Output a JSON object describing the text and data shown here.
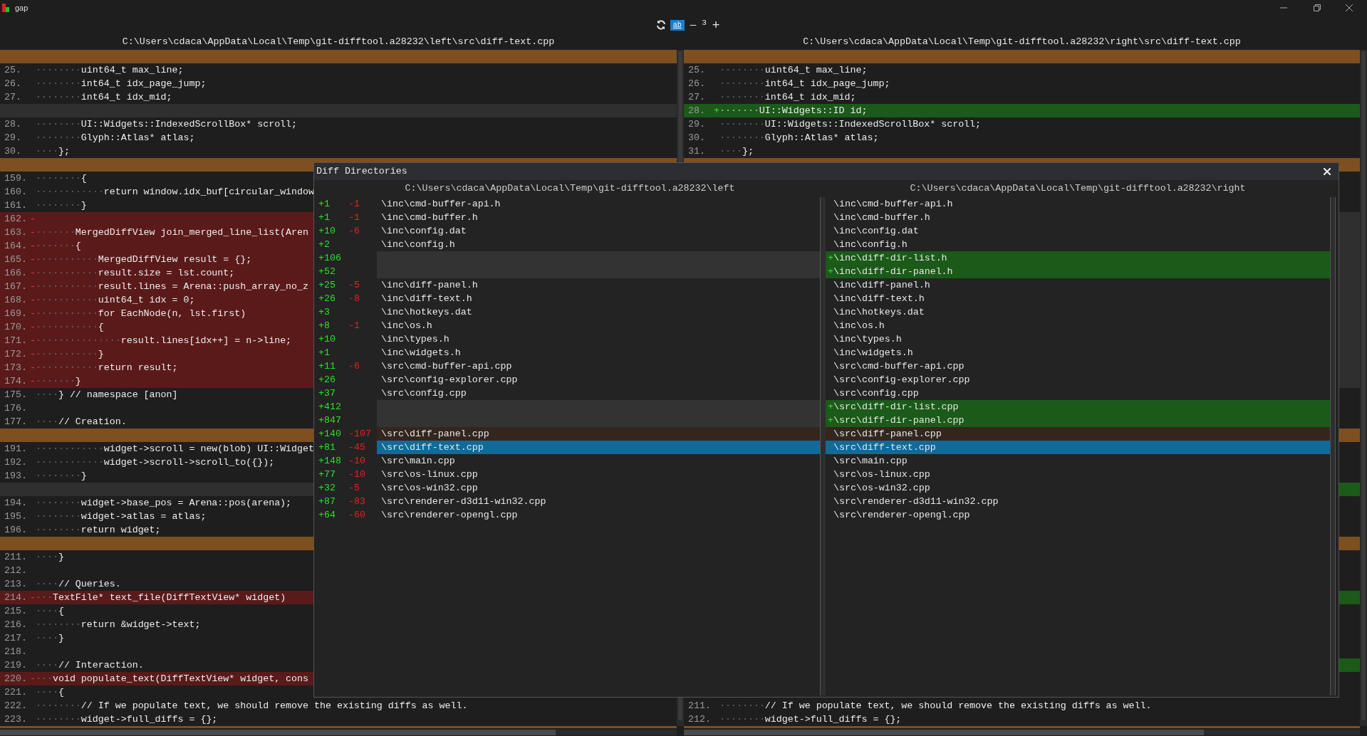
{
  "window": {
    "title": "gap"
  },
  "toolbar": {
    "whole_word": {
      "label": "ab",
      "on": true
    },
    "decrease": "—",
    "context_lines": "3",
    "increase": "+"
  },
  "left_pane": {
    "path": "C:\\Users\\cdaca\\AppData\\Local\\Temp\\git-difftool.a28232\\left\\src\\diff-text.cpp",
    "rows": [
      {
        "kind": "fold"
      },
      {
        "kind": "context",
        "number": "25.",
        "ws": "········",
        "code": "uint64_t max_line;"
      },
      {
        "kind": "context",
        "number": "26.",
        "ws": "········",
        "code": "int64_t idx_page_jump;"
      },
      {
        "kind": "context",
        "number": "27.",
        "ws": "········",
        "code": "int64_t idx_mid;"
      },
      {
        "kind": "gap"
      },
      {
        "kind": "context",
        "number": "28.",
        "ws": "········",
        "code": "UI::Widgets::IndexedScrollBox* scroll;"
      },
      {
        "kind": "context",
        "number": "29.",
        "ws": "········",
        "code": "Glyph::Atlas* atlas;"
      },
      {
        "kind": "context",
        "number": "30.",
        "ws": "····",
        "code": "};"
      },
      {
        "kind": "fold"
      },
      {
        "kind": "context",
        "number": "159.",
        "ws": "········",
        "code": "{"
      },
      {
        "kind": "context",
        "number": "160.",
        "ws": "············",
        "code": "return window.idx_buf[circular_window"
      },
      {
        "kind": "context",
        "number": "161.",
        "ws": "········",
        "code": "}"
      },
      {
        "kind": "deleted",
        "number": "162.",
        "marker": "-"
      },
      {
        "kind": "deleted",
        "number": "163.",
        "marker": "-",
        "ws": "·······",
        "code": "MergedDiffView join_merged_line_list(Aren"
      },
      {
        "kind": "deleted",
        "number": "164.",
        "marker": "-",
        "ws": "·······",
        "code": "{"
      },
      {
        "kind": "deleted",
        "number": "165.",
        "marker": "-",
        "ws": "···········",
        "code": "MergedDiffView result = {};"
      },
      {
        "kind": "deleted",
        "number": "166.",
        "marker": "-",
        "ws": "···········",
        "code": "result.size = lst.count;"
      },
      {
        "kind": "deleted",
        "number": "167.",
        "marker": "-",
        "ws": "···········",
        "code": "result.lines = Arena::push_array_no_z"
      },
      {
        "kind": "deleted",
        "number": "168.",
        "marker": "-",
        "ws": "···········",
        "code": "uint64_t idx = 0;"
      },
      {
        "kind": "deleted",
        "number": "169.",
        "marker": "-",
        "ws": "···········",
        "code": "for EachNode(n, lst.first)"
      },
      {
        "kind": "deleted",
        "number": "170.",
        "marker": "-",
        "ws": "···········",
        "code": "{"
      },
      {
        "kind": "deleted",
        "number": "171.",
        "marker": "-",
        "ws": "···············",
        "code": "result.lines[idx++] = n->line;"
      },
      {
        "kind": "deleted",
        "number": "172.",
        "marker": "-",
        "ws": "···········",
        "code": "}"
      },
      {
        "kind": "deleted",
        "number": "173.",
        "marker": "-",
        "ws": "···········",
        "code": "return result;"
      },
      {
        "kind": "deleted",
        "number": "174.",
        "marker": "-",
        "ws": "·······",
        "code": "}"
      },
      {
        "kind": "context",
        "number": "175.",
        "ws": "····",
        "code": "} // namespace [anon]"
      },
      {
        "kind": "context",
        "number": "176."
      },
      {
        "kind": "context",
        "number": "177.",
        "ws": "····",
        "code": "// Creation."
      },
      {
        "kind": "fold"
      },
      {
        "kind": "context",
        "number": "191.",
        "ws": "············",
        "code": "widget->scroll = new(blob) UI::Widget"
      },
      {
        "kind": "context",
        "number": "192.",
        "ws": "············",
        "code": "widget->scroll->scroll_to({});"
      },
      {
        "kind": "context",
        "number": "193.",
        "ws": "········",
        "code": "}"
      },
      {
        "kind": "gap"
      },
      {
        "kind": "context",
        "number": "194.",
        "ws": "········",
        "code": "widget->base_pos = Arena::pos(arena);"
      },
      {
        "kind": "context",
        "number": "195.",
        "ws": "········",
        "code": "widget->atlas = atlas;"
      },
      {
        "kind": "context",
        "number": "196.",
        "ws": "········",
        "code": "return widget;"
      },
      {
        "kind": "fold"
      },
      {
        "kind": "context",
        "number": "211.",
        "ws": "····",
        "code": "}"
      },
      {
        "kind": "context",
        "number": "212."
      },
      {
        "kind": "context",
        "number": "213.",
        "ws": "····",
        "code": "// Queries."
      },
      {
        "kind": "deleted",
        "number": "214.",
        "marker": "-",
        "ws": "···",
        "code": "TextFile* text_file(DiffTextView* widget)"
      },
      {
        "kind": "context",
        "number": "215.",
        "ws": "····",
        "code": "{"
      },
      {
        "kind": "context",
        "number": "216.",
        "ws": "········",
        "code": "return &widget->text;"
      },
      {
        "kind": "context",
        "number": "217.",
        "ws": "····",
        "code": "}"
      },
      {
        "kind": "context",
        "number": "218."
      },
      {
        "kind": "context",
        "number": "219.",
        "ws": "····",
        "code": "// Interaction."
      },
      {
        "kind": "deleted",
        "number": "220.",
        "marker": "-",
        "ws": "···",
        "code": "void populate_text(DiffTextView* widget, cons"
      },
      {
        "kind": "context",
        "number": "221.",
        "ws": "····",
        "code": "{"
      },
      {
        "kind": "context",
        "number": "222.",
        "ws": "········",
        "code": "// If we populate text, we should remove the existing diffs as well."
      },
      {
        "kind": "context",
        "number": "223.",
        "ws": "········",
        "code": "widget->full_diffs = {};"
      }
    ]
  },
  "right_pane": {
    "path": "C:\\Users\\cdaca\\AppData\\Local\\Temp\\git-difftool.a28232\\right\\src\\diff-text.cpp",
    "rows": [
      {
        "kind": "fold"
      },
      {
        "kind": "context",
        "number": "25.",
        "ws": "········",
        "code": "uint64_t max_line;"
      },
      {
        "kind": "context",
        "number": "26.",
        "ws": "········",
        "code": "int64_t idx_page_jump;"
      },
      {
        "kind": "context",
        "number": "27.",
        "ws": "········",
        "code": "int64_t idx_mid;"
      },
      {
        "kind": "added",
        "number": "28.",
        "marker": "+",
        "ws": "·······",
        "code": "UI::Widgets::ID id;"
      },
      {
        "kind": "context",
        "number": "29.",
        "ws": "········",
        "code": "UI::Widgets::IndexedScrollBox* scroll;"
      },
      {
        "kind": "context",
        "number": "30.",
        "ws": "········",
        "code": "Glyph::Atlas* atlas;"
      },
      {
        "kind": "context",
        "number": "31.",
        "ws": "····",
        "code": "};"
      },
      {
        "kind": "fold"
      },
      {
        "kind": "context"
      },
      {
        "kind": "context"
      },
      {
        "kind": "context"
      },
      {
        "kind": "gap"
      },
      {
        "kind": "gap"
      },
      {
        "kind": "gap"
      },
      {
        "kind": "gap"
      },
      {
        "kind": "gap"
      },
      {
        "kind": "gap"
      },
      {
        "kind": "gap"
      },
      {
        "kind": "gap"
      },
      {
        "kind": "gap"
      },
      {
        "kind": "gap"
      },
      {
        "kind": "gap"
      },
      {
        "kind": "gap"
      },
      {
        "kind": "gap"
      },
      {
        "kind": "context"
      },
      {
        "kind": "context"
      },
      {
        "kind": "context"
      },
      {
        "kind": "fold"
      },
      {
        "kind": "context"
      },
      {
        "kind": "context"
      },
      {
        "kind": "context"
      },
      {
        "kind": "added"
      },
      {
        "kind": "context"
      },
      {
        "kind": "context"
      },
      {
        "kind": "context"
      },
      {
        "kind": "fold"
      },
      {
        "kind": "context"
      },
      {
        "kind": "context"
      },
      {
        "kind": "context"
      },
      {
        "kind": "added"
      },
      {
        "kind": "context"
      },
      {
        "kind": "context"
      },
      {
        "kind": "context"
      },
      {
        "kind": "context"
      },
      {
        "kind": "added"
      },
      {
        "kind": "context"
      },
      {
        "kind": "context"
      },
      {
        "kind": "context",
        "number": "211.",
        "ws": "········",
        "code": "// If we populate text, we should remove the existing diffs as well."
      },
      {
        "kind": "context",
        "number": "212.",
        "ws": "········",
        "code": "widget->full_diffs = {};"
      }
    ]
  },
  "dialog": {
    "title": "Diff Directories",
    "left_path": "C:\\Users\\cdaca\\AppData\\Local\\Temp\\git-difftool.a28232\\left",
    "right_path": "C:\\Users\\cdaca\\AppData\\Local\\Temp\\git-difftool.a28232\\right",
    "rows": [
      {
        "kind": "both",
        "added": "+1",
        "removed": "-1",
        "left": "\\inc\\cmd-buffer-api.h",
        "right": "\\inc\\cmd-buffer-api.h",
        "selected": false,
        "highlighted": false
      },
      {
        "kind": "both",
        "added": "+1",
        "removed": "-1",
        "left": "\\inc\\cmd-buffer.h",
        "right": "\\inc\\cmd-buffer.h",
        "selected": false,
        "highlighted": false
      },
      {
        "kind": "both",
        "added": "+10",
        "removed": "-6",
        "left": "\\inc\\config.dat",
        "right": "\\inc\\config.dat",
        "selected": false,
        "highlighted": false
      },
      {
        "kind": "both",
        "added": "+2",
        "left": "\\inc\\config.h",
        "right": "\\inc\\config.h",
        "selected": false,
        "highlighted": false
      },
      {
        "kind": "new",
        "added": "+106",
        "marker": "+",
        "right": "\\inc\\diff-dir-list.h",
        "selected": false,
        "highlighted": false
      },
      {
        "kind": "new",
        "added": "+52",
        "marker": "+",
        "right": "\\inc\\diff-dir-panel.h",
        "selected": false,
        "highlighted": false
      },
      {
        "kind": "both",
        "added": "+25",
        "removed": "-5",
        "left": "\\inc\\diff-panel.h",
        "right": "\\inc\\diff-panel.h",
        "selected": false,
        "highlighted": false
      },
      {
        "kind": "both",
        "added": "+26",
        "removed": "-8",
        "left": "\\inc\\diff-text.h",
        "right": "\\inc\\diff-text.h",
        "selected": false,
        "highlighted": false
      },
      {
        "kind": "both",
        "added": "+3",
        "left": "\\inc\\hotkeys.dat",
        "right": "\\inc\\hotkeys.dat",
        "selected": false,
        "highlighted": false
      },
      {
        "kind": "both",
        "added": "+8",
        "removed": "-1",
        "left": "\\inc\\os.h",
        "right": "\\inc\\os.h",
        "selected": false,
        "highlighted": false
      },
      {
        "kind": "both",
        "added": "+10",
        "left": "\\inc\\types.h",
        "right": "\\inc\\types.h",
        "selected": false,
        "highlighted": false
      },
      {
        "kind": "both",
        "added": "+1",
        "left": "\\inc\\widgets.h",
        "right": "\\inc\\widgets.h",
        "selected": false,
        "highlighted": false
      },
      {
        "kind": "both",
        "added": "+11",
        "removed": "-6",
        "left": "\\src\\cmd-buffer-api.cpp",
        "right": "\\src\\cmd-buffer-api.cpp",
        "selected": false,
        "highlighted": false
      },
      {
        "kind": "both",
        "added": "+26",
        "left": "\\src\\config-explorer.cpp",
        "right": "\\src\\config-explorer.cpp",
        "selected": false,
        "highlighted": false
      },
      {
        "kind": "both",
        "added": "+37",
        "left": "\\src\\config.cpp",
        "right": "\\src\\config.cpp",
        "selected": false,
        "highlighted": false
      },
      {
        "kind": "new",
        "added": "+412",
        "marker": "+",
        "right": "\\src\\diff-dir-list.cpp",
        "selected": false,
        "highlighted": false
      },
      {
        "kind": "new",
        "added": "+847",
        "marker": "+",
        "right": "\\src\\diff-dir-panel.cpp",
        "selected": false,
        "highlighted": false
      },
      {
        "kind": "both",
        "added": "+140",
        "removed": "-107",
        "left": "\\src\\diff-panel.cpp",
        "right": "\\src\\diff-panel.cpp",
        "selected": false,
        "highlighted": true
      },
      {
        "kind": "both",
        "added": "+81",
        "removed": "-45",
        "left": "\\src\\diff-text.cpp",
        "right": "\\src\\diff-text.cpp",
        "selected": true,
        "highlighted": false
      },
      {
        "kind": "both",
        "added": "+148",
        "removed": "-10",
        "left": "\\src\\main.cpp",
        "right": "\\src\\main.cpp",
        "selected": false,
        "highlighted": false
      },
      {
        "kind": "both",
        "added": "+77",
        "removed": "-10",
        "left": "\\src\\os-linux.cpp",
        "right": "\\src\\os-linux.cpp",
        "selected": false,
        "highlighted": false
      },
      {
        "kind": "both",
        "added": "+32",
        "removed": "-5",
        "left": "\\src\\os-win32.cpp",
        "right": "\\src\\os-win32.cpp",
        "selected": false,
        "highlighted": false
      },
      {
        "kind": "both",
        "added": "+87",
        "removed": "-83",
        "left": "\\src\\renderer-d3d11-win32.cpp",
        "right": "\\src\\renderer-d3d11-win32.cpp",
        "selected": false,
        "highlighted": false
      },
      {
        "kind": "both",
        "added": "+64",
        "removed": "-60",
        "left": "\\src\\renderer-opengl.cpp",
        "right": "\\src\\renderer-opengl.cpp",
        "selected": false,
        "highlighted": false
      }
    ]
  }
}
